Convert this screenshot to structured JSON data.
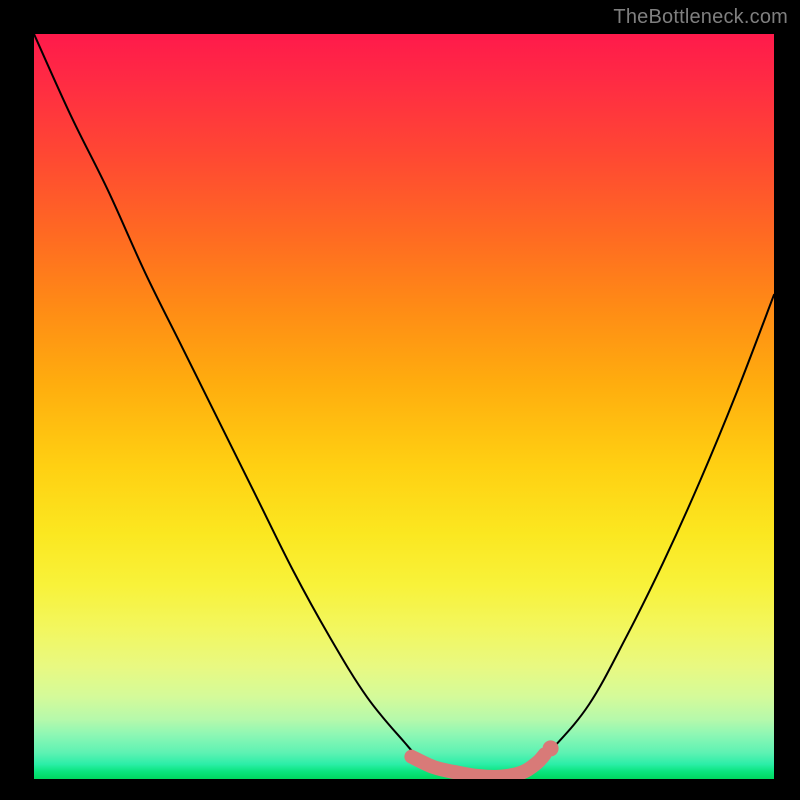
{
  "watermark": {
    "text": "TheBottleneck.com"
  },
  "colors": {
    "curve_stroke": "#000000",
    "marker_stroke": "#d87a78",
    "marker_fill": "#d87a78",
    "background": "#000000"
  },
  "chart_data": {
    "type": "line",
    "title": "",
    "xlabel": "",
    "ylabel": "",
    "xlim": [
      0,
      100
    ],
    "ylim": [
      0,
      100
    ],
    "grid": false,
    "legend": null,
    "series": [
      {
        "name": "bottleneck-curve",
        "x": [
          0,
          5,
          10,
          15,
          20,
          25,
          30,
          35,
          40,
          45,
          50,
          52,
          55,
          58,
          60,
          63,
          66,
          68,
          70,
          75,
          80,
          85,
          90,
          95,
          100
        ],
        "y": [
          100,
          89,
          79,
          68,
          58,
          48,
          38,
          28,
          19,
          11,
          5,
          3,
          1.5,
          0.7,
          0.3,
          0.3,
          0.8,
          2,
          4,
          10,
          19,
          29,
          40,
          52,
          65
        ]
      }
    ],
    "markers": {
      "name": "highlight-band",
      "x": [
        51,
        54,
        57,
        60,
        63,
        66,
        68,
        69
      ],
      "y": [
        3,
        1.6,
        0.9,
        0.4,
        0.3,
        0.9,
        2.2,
        3.3
      ]
    }
  }
}
